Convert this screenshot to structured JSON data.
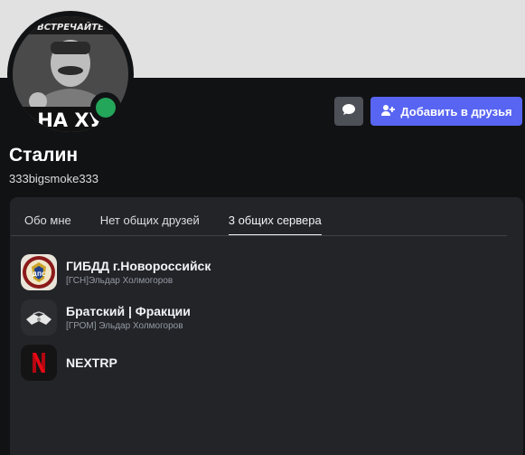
{
  "user": {
    "display_name": "Сталин",
    "username": "333bigsmoke333",
    "status_color": "#23a55a",
    "avatar_caption_top": "ВСТРЕЧАЙТЕ",
    "avatar_caption_bottom": "НА ХУ"
  },
  "actions": {
    "message_icon": "chat-bubble-icon",
    "add_friend_icon": "add-friend-icon",
    "add_friend_label": "Добавить в друзья"
  },
  "tabs": [
    {
      "label": "Обо мне",
      "active": false
    },
    {
      "label": "Нет общих друзей",
      "active": false
    },
    {
      "label": "3 общих сервера",
      "active": true
    }
  ],
  "servers": [
    {
      "name": "ГИБДД г.Новороссийск",
      "nickname": "[ГСН]Эльдар Холмогоров",
      "icon": "police-badge-icon",
      "badge_text": "ДПС"
    },
    {
      "name": "Братский | Фракции",
      "nickname": "[ГРОМ] Эльдар Холмогоров",
      "icon": "handshake-icon"
    },
    {
      "name": "NEXTRP",
      "nickname": "",
      "icon": "netflix-n-icon"
    }
  ],
  "colors": {
    "accent": "#5865f2",
    "banner": "#e1e1e1",
    "card": "#232428",
    "online": "#23a55a"
  }
}
